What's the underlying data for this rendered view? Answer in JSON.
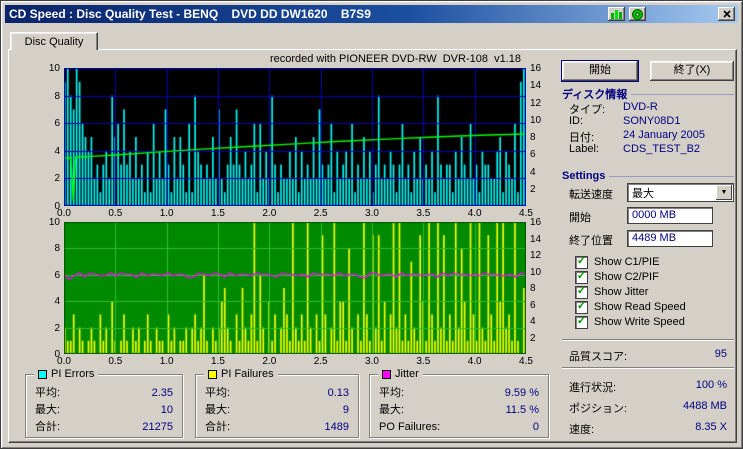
{
  "window": {
    "title": "CD Speed : Disc Quality Test - BENQ    DVD DD DW1620    B7S9"
  },
  "icons": {
    "titlebar": [
      "chart-icon",
      "disc-icon",
      "close-icon"
    ],
    "check": "✓",
    "dropdown_arrow": "▼"
  },
  "tab": {
    "label": "Disc Quality"
  },
  "recorded_text": "recorded with PIONEER DVD-RW  DVR-108  v1.18",
  "chart_data": {
    "type": "bar+line",
    "x_axis": {
      "unit": "GB",
      "range": [
        0,
        4.5
      ],
      "ticks": [
        "0.0",
        "0.5",
        "1.0",
        "1.5",
        "2.0",
        "2.5",
        "3.0",
        "3.5",
        "4.0",
        "4.5"
      ]
    },
    "top_chart": {
      "bg": "#000000",
      "grid": "#0000bb",
      "border": "#0000bb",
      "left_axis": {
        "range": [
          0,
          10
        ],
        "ticks": [
          "10",
          "8",
          "6",
          "4",
          "2",
          "0"
        ]
      },
      "right_axis": {
        "range": [
          0,
          16
        ],
        "ticks": [
          "16",
          "14",
          "12",
          "10",
          "8",
          "6",
          "4",
          "2"
        ]
      },
      "series": [
        {
          "name": "PI Errors",
          "type": "bar",
          "color": "#00ffff",
          "scale": "left",
          "values_hex": "9a87a965452313428563734252314162427315253161843232527213537324236162428313224251423252732361423426132524138232431362314252324183233142532623143322451432619a"
        },
        {
          "name": "Write Speed",
          "type": "line",
          "color": "#00ff00",
          "scale": "right",
          "points": [
            [
              0.0,
              5.55
            ],
            [
              0.015,
              5.6
            ],
            [
              0.02,
              0.6
            ],
            [
              0.025,
              5.65
            ],
            [
              0.06,
              5.75
            ],
            [
              0.12,
              5.95
            ],
            [
              0.2,
              6.25
            ],
            [
              0.3,
              6.6
            ],
            [
              0.4,
              6.9
            ],
            [
              0.5,
              7.2
            ],
            [
              0.6,
              7.5
            ],
            [
              0.7,
              7.75
            ],
            [
              0.8,
              8.0
            ],
            [
              0.9,
              8.2
            ],
            [
              1.0,
              8.35
            ]
          ]
        }
      ]
    },
    "bottom_chart": {
      "bg": "#008a00",
      "grid": "#2fbf2f",
      "border": "#005500",
      "left_axis": {
        "range": [
          0,
          10
        ],
        "ticks": [
          "10",
          "8",
          "6",
          "4",
          "2",
          "0"
        ]
      },
      "right_axis": {
        "range": [
          0,
          16
        ],
        "ticks": [
          "16",
          "14",
          "12",
          "10",
          "8",
          "6",
          "4",
          "2"
        ]
      },
      "series": [
        {
          "name": "PI Failures",
          "type": "bar",
          "color": "#ffff00",
          "scale": "left",
          "values_hex": "2113021012103120410131021201310211031201120231261021245210315213a162041302531a2131a20319302a144182031a319291403a2a131721941a31a29131a2841a31a21931a4a231a105"
        },
        {
          "name": "Jitter",
          "type": "line",
          "color": "#ff00ff",
          "scale": "right",
          "encode": {
            "base": 8.9,
            "step": 0.15
          },
          "values_digits": "514636544646553645546455236546536455465543655453655546455326645536455455364655454655445365"
        }
      ]
    }
  },
  "stat_panels": [
    {
      "title": "PI Errors",
      "swatch": "#00ffff",
      "rows": [
        {
          "label": "平均:",
          "value": "2.35"
        },
        {
          "label": "最大:",
          "value": "10"
        },
        {
          "label": "合計:",
          "value": "21275"
        }
      ]
    },
    {
      "title": "PI Failures",
      "swatch": "#ffff00",
      "rows": [
        {
          "label": "平均:",
          "value": "0.13"
        },
        {
          "label": "最大:",
          "value": "9"
        },
        {
          "label": "合計:",
          "value": "1489"
        }
      ]
    },
    {
      "title": "Jitter",
      "swatch": "#ff00ff",
      "rows": [
        {
          "label": "平均:",
          "value": "9.59 %"
        },
        {
          "label": "最大:",
          "value": "11.5 %"
        },
        {
          "label": "PO Failures:",
          "value": "0"
        }
      ]
    }
  ],
  "side_panel": {
    "start_button": "開始",
    "exit_button": "終了(X)",
    "disc_info": {
      "header": "ディスク情報",
      "rows": [
        {
          "label": "タイプ:",
          "value": "DVD-R"
        },
        {
          "label": "ID:",
          "value": "SONY08D1"
        },
        {
          "label": "日付:",
          "value": "24 January 2005"
        },
        {
          "label": "Label:",
          "value": "CDS_TEST_B2"
        }
      ]
    },
    "settings": {
      "header": "Settings",
      "transfer_label": "転送速度",
      "transfer_value": "最大",
      "start_label": "開始",
      "start_value": "0000 MB",
      "end_label": "終了位置",
      "end_value": "4489 MB",
      "checkboxes": [
        {
          "label": "Show C1/PIE",
          "checked": true
        },
        {
          "label": "Show C2/PIF",
          "checked": true
        },
        {
          "label": "Show Jitter",
          "checked": true
        },
        {
          "label": "Show Read Speed",
          "checked": true
        },
        {
          "label": "Show Write Speed",
          "checked": true
        }
      ]
    },
    "quality": {
      "label": "品質スコア:",
      "value": "95"
    },
    "status_rows": [
      {
        "label": "進行状況:",
        "value": "100 %"
      },
      {
        "label": "ポジション:",
        "value": "4488 MB"
      },
      {
        "label": "速度:",
        "value": "8.35 X"
      }
    ]
  }
}
